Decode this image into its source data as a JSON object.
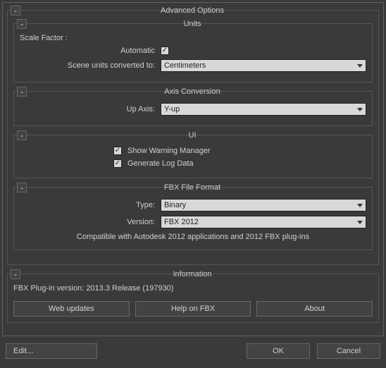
{
  "outer": {
    "title": "Advanced Options"
  },
  "units": {
    "title": "Units",
    "scale_factor_label": "Scale Factor :",
    "automatic_label": "Automatic",
    "automatic_checked": true,
    "converted_label": "Scene units converted to:",
    "converted_value": "Centimeters"
  },
  "axis": {
    "title": "Axis Conversion",
    "up_axis_label": "Up Axis:",
    "up_axis_value": "Y-up"
  },
  "ui": {
    "title": "UI",
    "warning_label": "Show Warning Manager",
    "warning_checked": true,
    "log_label": "Generate Log Data",
    "log_checked": true
  },
  "fbx": {
    "title": "FBX File Format",
    "type_label": "Type:",
    "type_value": "Binary",
    "version_label": "Version:",
    "version_value": "FBX 2012",
    "compat_text": "Compatible with Autodesk 2012 applications and 2012 FBX plug-ins"
  },
  "info": {
    "title": "Information",
    "plugin_text": "FBX Plug-in version: 2013.3 Release (197930)",
    "web_updates": "Web updates",
    "help": "Help on FBX",
    "about": "About"
  },
  "footer": {
    "edit": "Edit...",
    "ok": "OK",
    "cancel": "Cancel"
  }
}
